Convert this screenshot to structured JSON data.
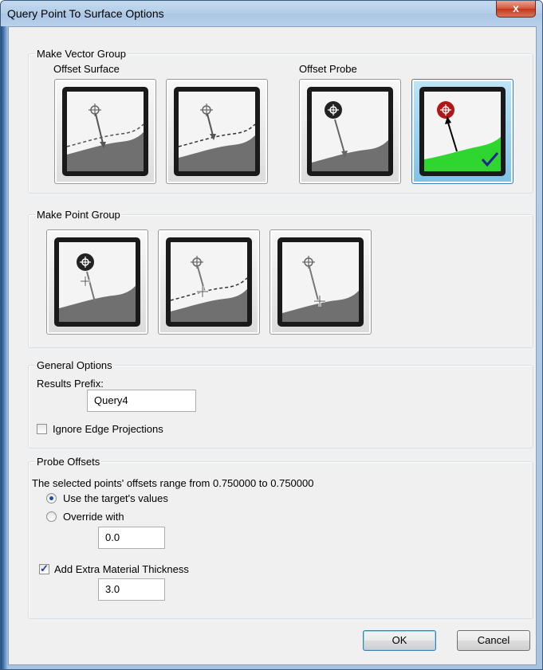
{
  "window": {
    "title": "Query Point To Surface Options",
    "close_glyph": "x"
  },
  "vector_group": {
    "legend": "Make Vector Group",
    "offset_surface_label": "Offset Surface",
    "offset_probe_label": "Offset Probe",
    "tiles": [
      {
        "icon": "offset-surface-arrow-icon",
        "selected": false
      },
      {
        "icon": "offset-surface-dashed-icon",
        "selected": false
      },
      {
        "icon": "offset-probe-icon",
        "selected": false
      },
      {
        "icon": "offset-probe-selected-icon",
        "selected": true
      }
    ]
  },
  "point_group": {
    "legend": "Make Point Group",
    "tiles": [
      {
        "icon": "point-probe-icon"
      },
      {
        "icon": "point-dashed-surface-icon"
      },
      {
        "icon": "point-surface-icon"
      }
    ]
  },
  "general": {
    "legend": "General Options",
    "results_prefix_label": "Results Prefix:",
    "results_prefix_value": "Query4",
    "ignore_edge_label": "Ignore Edge Projections",
    "ignore_edge_checked": false
  },
  "probe": {
    "legend": "Probe Offsets",
    "range_text": "The selected points' offsets range from 0.750000 to 0.750000",
    "use_target_label": "Use the target's values",
    "override_label": "Override with",
    "override_value": "0.0",
    "extra_thickness_label": "Add Extra Material Thickness",
    "extra_thickness_checked": true,
    "extra_thickness_value": "3.0"
  },
  "buttons": {
    "ok": "OK",
    "cancel": "Cancel"
  },
  "colors": {
    "selected_fill": "#7fc2e8",
    "surface_green": "#2fd62f",
    "probe_red": "#b01818"
  }
}
